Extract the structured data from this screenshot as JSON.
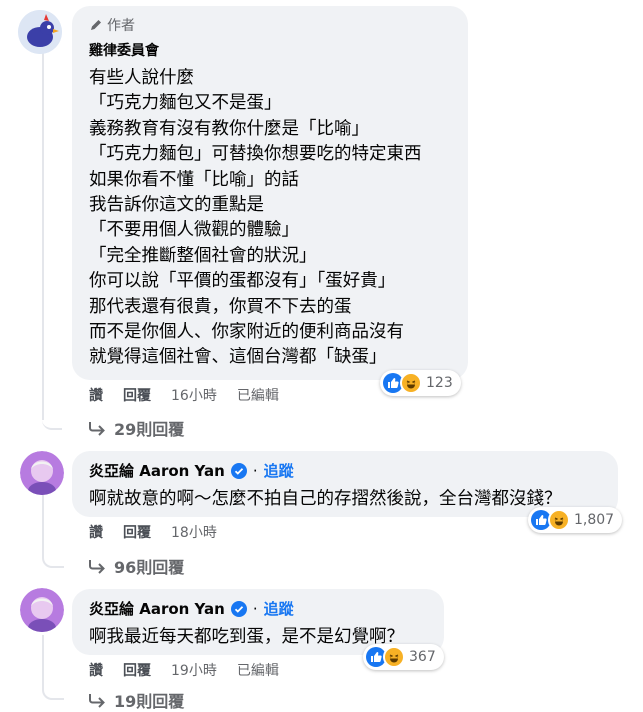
{
  "comments": [
    {
      "author_label": "作者",
      "author": "雞律委員會",
      "lines": [
        "有些人說什麼",
        "「巧克力麵包又不是蛋」",
        "義務教育有沒有教你什麼是「比喻」",
        "「巧克力麵包」可替換你想要吃的特定東西",
        "如果你看不懂「比喻」的話",
        "我告訴你這文的重點是",
        "「不要用個人微觀的體驗」",
        "「完全推斷整個社會的狀況」",
        "你可以說「平價的蛋都沒有」「蛋好貴」",
        "那代表還有很貴，你買不下去的蛋",
        "而不是你個人、你家附近的便利商品沒有",
        "就覺得這個社會、這個台灣都「缺蛋」"
      ],
      "reaction_count": "123",
      "like": "讚",
      "reply": "回覆",
      "time": "16小時",
      "edited": "已編輯",
      "replies": "29則回覆"
    },
    {
      "author": "炎亞綸 Aaron Yan",
      "follow": "追蹤",
      "text": "啊就故意的啊～怎麼不拍自己的存摺然後說，全台灣都沒錢？",
      "reaction_count": "1,807",
      "like": "讚",
      "reply": "回覆",
      "time": "18小時",
      "replies": "96則回覆"
    },
    {
      "author": "炎亞綸 Aaron Yan",
      "follow": "追蹤",
      "text": "啊我最近每天都吃到蛋，是不是幻覺啊？",
      "reaction_count": "367",
      "like": "讚",
      "reply": "回覆",
      "time": "19小時",
      "edited": "已編輯",
      "replies": "19則回覆"
    }
  ],
  "colors": {
    "link": "#1877f2",
    "bubble": "#f0f2f5",
    "meta": "#65676b"
  },
  "icons": [
    "pencil-icon",
    "verified-icon",
    "like-reaction-icon",
    "haha-reaction-icon",
    "reply-arrow-icon"
  ]
}
